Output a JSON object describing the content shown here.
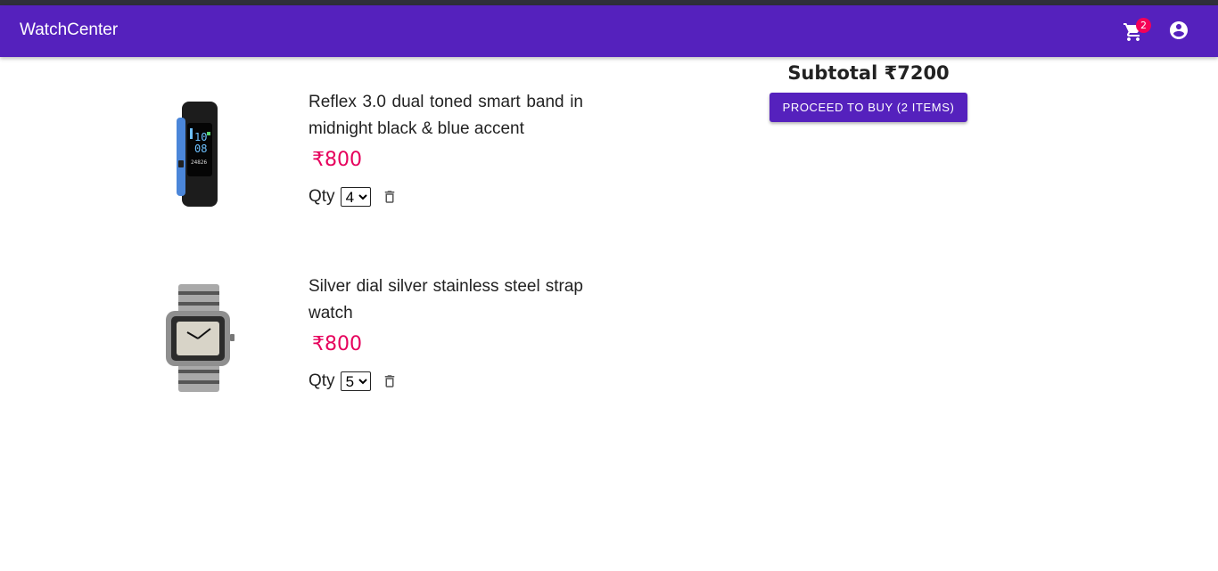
{
  "app": {
    "title": "WatchCenter"
  },
  "header": {
    "cart_count": "2",
    "cart_icon": "shopping-cart-icon",
    "account_icon": "account-circle-icon"
  },
  "cart": {
    "items": [
      {
        "title": "Reflex 3.0 dual toned smart band in midnight black & blue accent",
        "price": "₹800",
        "qty_label": "Qty",
        "qty_value": "4",
        "image_icon": "smart-band-image"
      },
      {
        "title": "Silver dial silver stainless steel strap watch",
        "price": "₹800",
        "qty_label": "Qty",
        "qty_value": "5",
        "image_icon": "steel-watch-image"
      }
    ]
  },
  "summary": {
    "subtotal": "Subtotal ₹7200",
    "proceed_label": "PROCEED TO BUY (2 ITEMS)"
  },
  "colors": {
    "primary": "#5521bd",
    "price": "#e6005c",
    "badge": "#f50057"
  }
}
